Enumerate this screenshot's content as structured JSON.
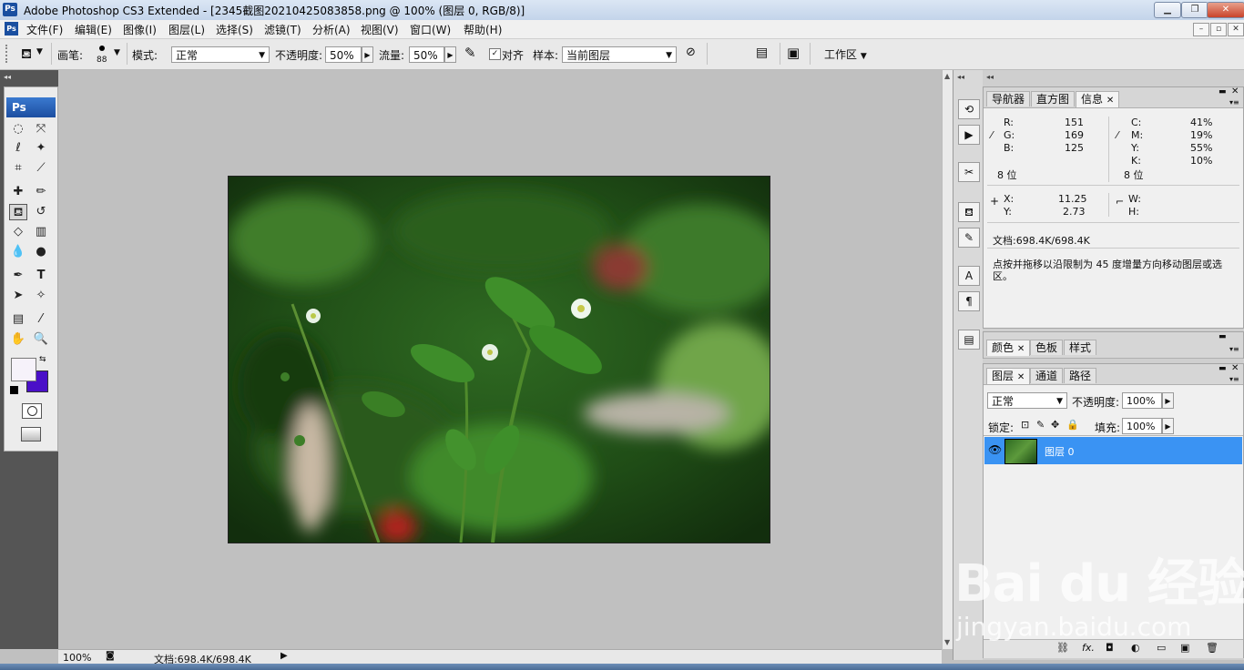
{
  "window": {
    "app_badge": "Ps",
    "title": "Adobe Photoshop CS3 Extended - [2345截图20210425083858.png @ 100% (图层 0, RGB/8)]",
    "minimize": "▁",
    "restore": "❐",
    "close": "✕"
  },
  "menu": {
    "items": [
      "文件(F)",
      "编辑(E)",
      "图像(I)",
      "图层(L)",
      "选择(S)",
      "滤镜(T)",
      "分析(A)",
      "视图(V)",
      "窗口(W)",
      "帮助(H)"
    ],
    "mdi_min": "–",
    "mdi_restore": "▫",
    "mdi_close": "✕"
  },
  "options": {
    "brush_label": "画笔:",
    "brush_size": "88",
    "mode_label": "模式:",
    "mode_value": "正常",
    "opacity_label": "不透明度:",
    "opacity_value": "50%",
    "flow_label": "流量:",
    "flow_value": "50%",
    "aligned_label": "对齐",
    "sample_label": "样本:",
    "sample_value": "当前图层",
    "workspace_label": "工作区"
  },
  "toolbox": {
    "badge": "Ps",
    "colors": {
      "foreground": "#f6f2fa",
      "background": "#4a10c8"
    }
  },
  "status": {
    "zoom": "100%",
    "doc_info": "文档:698.4K/698.4K"
  },
  "info_panel": {
    "tabs": [
      "导航器",
      "直方图",
      "信息"
    ],
    "rgb": [
      {
        "k": "R:",
        "v": "151"
      },
      {
        "k": "G:",
        "v": "169"
      },
      {
        "k": "B:",
        "v": "125"
      }
    ],
    "cmyk": [
      {
        "k": "C:",
        "v": "41%"
      },
      {
        "k": "M:",
        "v": "19%"
      },
      {
        "k": "Y:",
        "v": "55%"
      },
      {
        "k": "K:",
        "v": "10%"
      }
    ],
    "bits_left": "8 位",
    "bits_right": "8 位",
    "x_label": "X:",
    "x_value": "11.25",
    "y_label": "Y:",
    "y_value": "2.73",
    "w_label": "W:",
    "h_label": "H:",
    "doc": "文档:698.4K/698.4K",
    "hint": "点按并拖移以沿限制为 45 度增量方向移动图层或选区。"
  },
  "color_panel": {
    "tabs": [
      "颜色",
      "色板",
      "样式"
    ]
  },
  "layers_panel": {
    "tabs": [
      "图层",
      "通道",
      "路径"
    ],
    "blend_mode": "正常",
    "opacity_label": "不透明度:",
    "opacity_value": "100%",
    "lock_label": "锁定:",
    "fill_label": "填充:",
    "fill_value": "100%",
    "layer_name": "图层 0",
    "footer_fx": "fx."
  },
  "watermark": {
    "brand": "Bai du 经验",
    "url": "jingyan.baidu.com"
  }
}
